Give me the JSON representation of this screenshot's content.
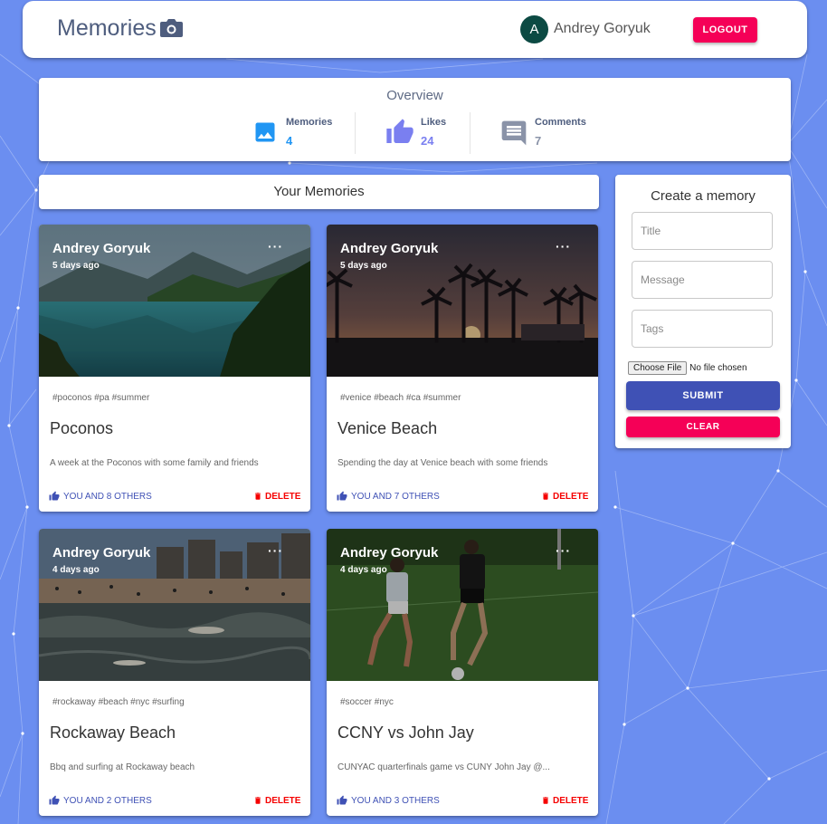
{
  "header": {
    "title": "Memories",
    "user_initial": "A",
    "user_name": "Andrey Goryuk",
    "logout_label": "LOGOUT"
  },
  "overview": {
    "title": "Overview",
    "stats": [
      {
        "label": "Memories",
        "value": "4",
        "icon": "image-icon",
        "color": "#2196f3"
      },
      {
        "label": "Likes",
        "value": "24",
        "icon": "thumb-up-icon",
        "color": "#7a7ff0"
      },
      {
        "label": "Comments",
        "value": "7",
        "icon": "comment-icon",
        "color": "#8a93a8"
      }
    ]
  },
  "memories_heading": "Your Memories",
  "cards": [
    {
      "author": "Andrey Goryuk",
      "time": "5 days ago",
      "more": "···",
      "tags": "#poconos #pa #summer",
      "title": "Poconos",
      "message": "A week at the Poconos with some family and friends",
      "likes": "YOU AND 8 OTHERS",
      "delete": "DELETE",
      "image": "lake-landscape"
    },
    {
      "author": "Andrey Goryuk",
      "time": "5 days ago",
      "more": "···",
      "tags": "#venice #beach #ca #summer",
      "title": "Venice Beach",
      "message": "Spending the day at Venice beach with some friends",
      "likes": "YOU AND 7 OTHERS",
      "delete": "DELETE",
      "image": "palm-sunset"
    },
    {
      "author": "Andrey Goryuk",
      "time": "4 days ago",
      "more": "···",
      "tags": "#rockaway #beach #nyc #surfing",
      "title": "Rockaway Beach",
      "message": "Bbq and surfing at Rockaway beach",
      "likes": "YOU AND 2 OTHERS",
      "delete": "DELETE",
      "image": "beach-surf"
    },
    {
      "author": "Andrey Goryuk",
      "time": "4 days ago",
      "more": "···",
      "tags": "#soccer #nyc",
      "title": "CCNY vs John Jay",
      "message": "CUNYAC quarterfinals game vs CUNY John Jay @...",
      "likes": "YOU AND 3 OTHERS",
      "delete": "DELETE",
      "image": "soccer-match"
    }
  ],
  "form": {
    "title": "Create a memory",
    "title_placeholder": "Title",
    "message_placeholder": "Message",
    "tags_placeholder": "Tags",
    "file_button": "Choose File",
    "file_status": "No file chosen",
    "submit_label": "SUBMIT",
    "clear_label": "CLEAR"
  },
  "colors": {
    "background": "#6b8ef0",
    "primary": "#3f51b5",
    "secondary": "#f50057",
    "delete": "#f50000",
    "avatar": "#0c4a43"
  }
}
